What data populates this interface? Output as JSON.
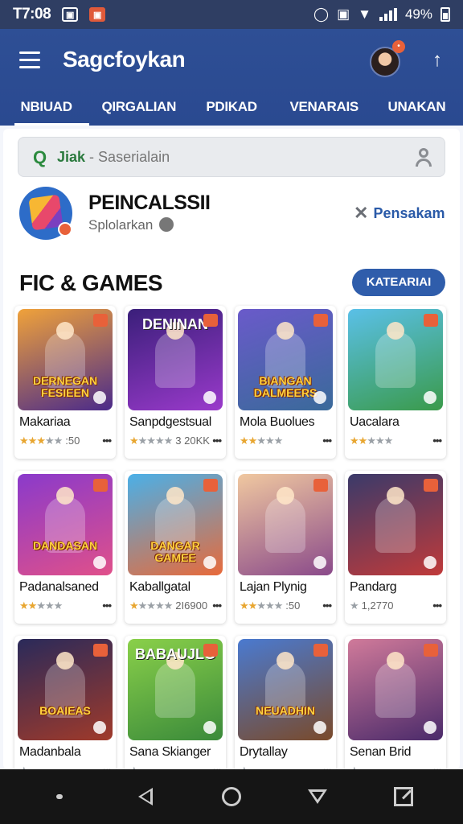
{
  "status_bar": {
    "time": "T7:08",
    "battery": "49%",
    "icon_a": "▣",
    "icon_b": "▣"
  },
  "app_bar": {
    "title": "Sagcfoykan",
    "notification_badge": "•"
  },
  "tabs": [
    {
      "label": "NBIUAD",
      "active": true
    },
    {
      "label": "QIRGALIAN",
      "active": false
    },
    {
      "label": "PDIKAD",
      "active": false
    },
    {
      "label": "VENARAIS",
      "active": false
    },
    {
      "label": "UNAKAN",
      "active": false
    }
  ],
  "search": {
    "brand": "Jiak",
    "separator": " - ",
    "placeholder": "Saserialain"
  },
  "featured": {
    "title": "PEINCALSSII",
    "subtitle": "Splolarkan",
    "action_label": "Pensakam"
  },
  "section": {
    "title": "FIC & GAMES",
    "button_label": "KATEARIAI"
  },
  "games": [
    {
      "name": "Makariaa",
      "art_text": "DERNEGAN FESIEEN",
      "meta": ":50",
      "rating": 3,
      "gradient": [
        "#f0a23a",
        "#4a2a8a"
      ],
      "text_pos": "bottom"
    },
    {
      "name": "Sanpdgestsual",
      "art_text": "DENINAN",
      "meta": "3 20KK",
      "rating": 1,
      "gradient": [
        "#3a1f7a",
        "#9a3acb"
      ],
      "text_pos": "top"
    },
    {
      "name": "Mola Buolues",
      "art_text": "BIANGAN DALMEERS",
      "meta": "",
      "rating": 2,
      "gradient": [
        "#6a5aca",
        "#3a6a9a"
      ],
      "text_pos": "bottom"
    },
    {
      "name": "Uacalara",
      "art_text": "",
      "meta": "",
      "rating": 2,
      "gradient": [
        "#5ac0e8",
        "#3a9a4a"
      ],
      "text_pos": "bottom"
    },
    {
      "name": "Padanalsaned",
      "art_text": "DANDASAN",
      "meta": "",
      "rating": 2,
      "gradient": [
        "#8a3acb",
        "#e0508a"
      ],
      "text_pos": "bottom"
    },
    {
      "name": "Kaballgatal",
      "art_text": "DANGAR GAMEE",
      "meta": "2I6900",
      "rating": 1,
      "gradient": [
        "#4ab0e8",
        "#e86a3a"
      ],
      "text_pos": "bottom"
    },
    {
      "name": "Lajan Plynig",
      "art_text": "",
      "meta": ":50",
      "rating": 2,
      "gradient": [
        "#f0c8a0",
        "#8a4a8a"
      ],
      "text_pos": "bottom"
    },
    {
      "name": "Pandarg",
      "art_text": "",
      "meta": "1,2770",
      "rating": 0,
      "gradient": [
        "#3a3a6a",
        "#c03a3a"
      ],
      "text_pos": "bottom"
    },
    {
      "name": "Madanbala",
      "art_text": "BOAIEAS",
      "meta": "",
      "rating": 0,
      "gradient": [
        "#2a2a5a",
        "#a03a2a"
      ],
      "text_pos": "bottom"
    },
    {
      "name": "Sana Skianger",
      "art_text": "BABAUJLG",
      "meta": "",
      "rating": 0,
      "gradient": [
        "#8ad04a",
        "#3a8a3a"
      ],
      "text_pos": "top"
    },
    {
      "name": "Drytallay",
      "art_text": "NEUADHIN",
      "meta": "",
      "rating": 0,
      "gradient": [
        "#4a7ad0",
        "#7a4a2a"
      ],
      "text_pos": "bottom"
    },
    {
      "name": "Senan Brid",
      "art_text": "",
      "meta": "",
      "rating": 0,
      "gradient": [
        "#d07a9a",
        "#4a2a6a"
      ],
      "text_pos": "bottom"
    }
  ]
}
